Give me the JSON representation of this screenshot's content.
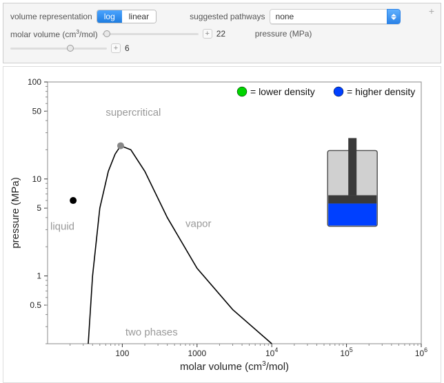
{
  "controls": {
    "volume_rep_label": "volume representation",
    "volume_rep_options": {
      "log": "log",
      "linear": "linear"
    },
    "volume_rep_active": "log",
    "pathways_label": "suggested pathways",
    "pathways_value": "none",
    "molar_volume_label_prefix": "molar volume (cm",
    "molar_volume_label_sup": "3",
    "molar_volume_label_suffix": "/mol)",
    "molar_volume_value": "22",
    "molar_volume_slider_pos_pct": 5,
    "pressure_label": "pressure (MPa)",
    "pressure_value": "6",
    "pressure_slider_pos_pct": 62
  },
  "legend": {
    "lower": "= lower density",
    "higher": "= higher density",
    "lower_color": "#00d400",
    "higher_color": "#0040ff"
  },
  "regions": {
    "supercritical": "supercritical",
    "liquid": "liquid",
    "vapor": "vapor",
    "two_phases": "two phases"
  },
  "axes": {
    "ylabel": "pressure (MPa)",
    "xlabel_prefix": "molar volume (cm",
    "xlabel_sup": "3",
    "xlabel_suffix": "/mol)"
  },
  "chart_data": {
    "type": "line",
    "title": "",
    "xlabel": "molar volume (cm^3/mol)",
    "ylabel": "pressure (MPa)",
    "x_scale": "log",
    "y_scale": "log",
    "xlim": [
      10,
      1000000
    ],
    "ylim": [
      0.2,
      100
    ],
    "x_ticks": [
      100,
      1000,
      10000,
      100000,
      1000000
    ],
    "x_tick_labels": [
      "100",
      "1000",
      "10⁴",
      "10⁵",
      "10⁶"
    ],
    "y_ticks": [
      0.5,
      1,
      5,
      10,
      50,
      100
    ],
    "y_tick_labels": [
      "0.5",
      "1",
      "5",
      "10",
      "50",
      "100"
    ],
    "series": [
      {
        "name": "phase envelope",
        "x": [
          35,
          40,
          50,
          65,
          80,
          95,
          130,
          200,
          400,
          1000,
          3000,
          10000
        ],
        "y": [
          0.2,
          1.0,
          5.0,
          12.0,
          18.0,
          22.0,
          20.0,
          12.0,
          4.0,
          1.2,
          0.45,
          0.2
        ]
      }
    ],
    "markers": [
      {
        "name": "state-point",
        "x": 22,
        "y": 6,
        "color": "#000000"
      },
      {
        "name": "critical-point",
        "x": 95,
        "y": 22,
        "color": "#888888"
      }
    ],
    "piston": {
      "fluid_color": "#0040ff",
      "fill_fraction": 0.3
    }
  }
}
